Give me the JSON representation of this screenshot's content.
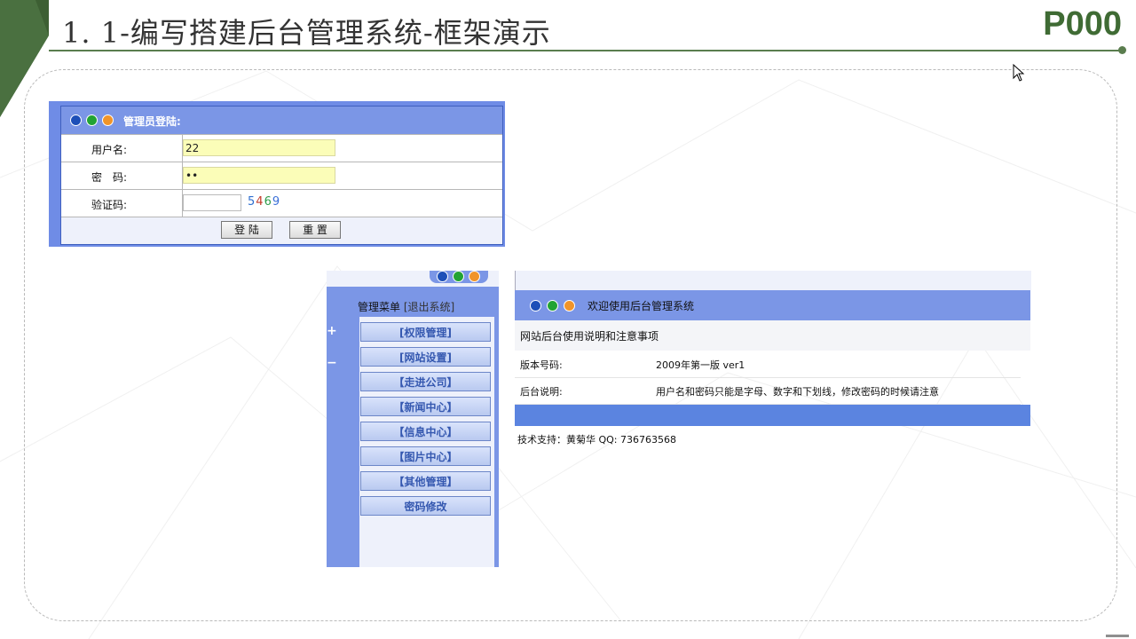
{
  "slide": {
    "title": "1. 1-编写搭建后台管理系统-框架演示",
    "page_code": "P000",
    "accent_color": "#3f6b34"
  },
  "login": {
    "header": "管理员登陆:",
    "username_label": "用户名:",
    "username_value": "22",
    "password_label": "密　码:",
    "password_value": "••",
    "captcha_label": "验证码:",
    "captcha_value": "",
    "captcha_digits": [
      "5",
      "4",
      "6",
      "9"
    ],
    "login_button": "登 陆",
    "reset_button": "重 置"
  },
  "admin": {
    "menu_title": "管理菜单",
    "logout_link": "[退出系统]",
    "menu_items": [
      "[权限管理]",
      "[网站设置]",
      "【走进公司】",
      "【新闻中心】",
      "【信息中心】",
      "【图片中心】",
      "【其他管理】",
      "密码修改"
    ],
    "welcome": "欢迎使用后台管理系统",
    "subtitle": "网站后台使用说明和注意事项",
    "version_label": "版本号码:",
    "version_value": "2009年第一版 ver1",
    "desc_label": "后台说明:",
    "desc_value": "用户名和密码只能是字母、数字和下划线，修改密码的时候请注意",
    "support": "技术支持：黄菊华 QQ: 736763568"
  },
  "colors": {
    "panel_blue": "#7b96e6",
    "bar_blue": "#5b84e0",
    "input_yellow": "#fbfdb8"
  }
}
